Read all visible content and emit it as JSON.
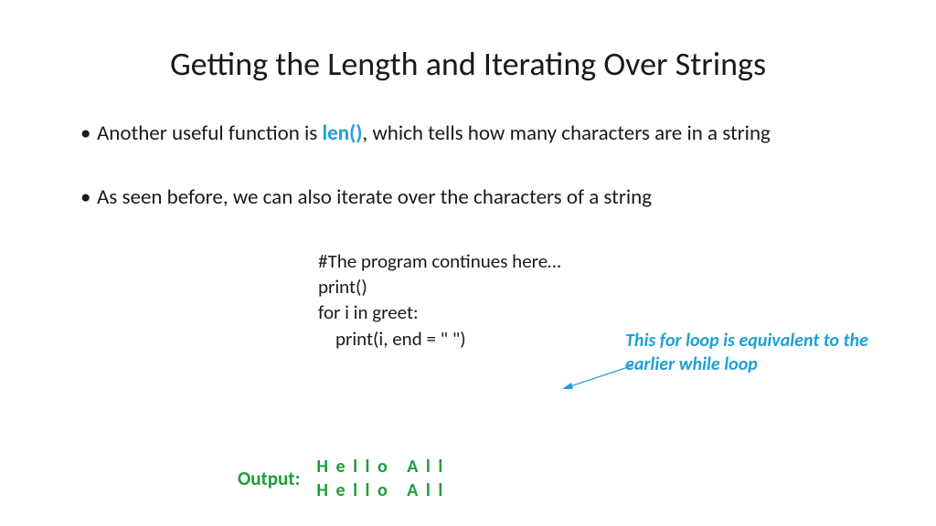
{
  "title": "Getting the Length and Iterating Over Strings",
  "bullets": [
    {
      "pre": "Another useful function is ",
      "highlight": "len()",
      "post": ", which tells how many characters are in a string"
    },
    {
      "pre": "As seen before, we can also iterate over the characters of a string",
      "highlight": "",
      "post": ""
    }
  ],
  "code": {
    "l1": "#The program continues here…",
    "l2": "print()",
    "l3": "",
    "l4": "for i in greet:",
    "l5": "    print(i, end = \" \")"
  },
  "annotation": "This for loop is equivalent to the earlier while loop",
  "output": {
    "label": "Output:",
    "line1": "H e l l o   A l l",
    "line2": "H e l l o   A l l"
  }
}
